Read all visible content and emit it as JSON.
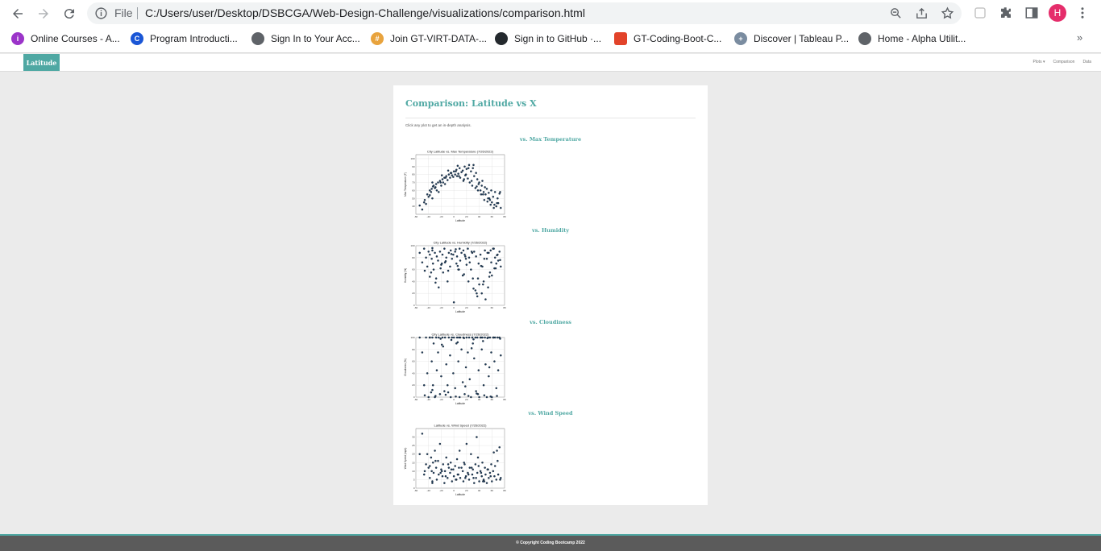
{
  "browser": {
    "file_label": "File",
    "url": "C:/Users/user/Desktop/DSBCGA/Web-Design-Challenge/visualizations/comparison.html",
    "profile_initial": "H",
    "bookmarks": [
      {
        "label": "Online Courses - A...",
        "icon": "globe-purple-icon",
        "color": "#9b34c9"
      },
      {
        "label": "Program Introducti...",
        "icon": "c-logo-icon",
        "color": "#1a56d6"
      },
      {
        "label": "Sign In to Your Acc...",
        "icon": "globe-icon",
        "color": "#5f6368"
      },
      {
        "label": "Join GT-VIRT-DATA-...",
        "icon": "slack-icon",
        "color": "#e8a33d"
      },
      {
        "label": "Sign in to GitHub ·...",
        "icon": "github-icon",
        "color": "#24292e"
      },
      {
        "label": "GT-Coding-Boot-C...",
        "icon": "gitlab-icon",
        "color": "#e2432a"
      },
      {
        "label": "Discover | Tableau P...",
        "icon": "tableau-icon",
        "color": "#7a8ca0"
      },
      {
        "label": "Home - Alpha Utilit...",
        "icon": "globe-icon",
        "color": "#5f6368"
      }
    ]
  },
  "site": {
    "brand": "Latitude",
    "nav": [
      "Plots ▾",
      "Comparison",
      "Data"
    ]
  },
  "page": {
    "title": "Comparison: Latitude vs X",
    "intro": "Click any plot to get an in-depth analysis.",
    "sections": [
      {
        "heading": "vs. Max Temperature"
      },
      {
        "heading": "vs. Humidity"
      },
      {
        "heading": "vs. Cloudiness"
      },
      {
        "heading": "vs. Wind Speed"
      }
    ]
  },
  "footer": {
    "text": "© Copyright Coding Bootcamp 2022"
  },
  "colors": {
    "accent": "#4fa8a3",
    "points": "#1f3d5c",
    "footer": "#5b5b5b"
  },
  "chart_data": [
    {
      "type": "scatter",
      "title": "City Latitude vs. Max Temperature (7/26/2022)",
      "xlabel": "Latitude",
      "ylabel": "Max Temperature (F)",
      "xlim": [
        -60,
        80
      ],
      "ylim": [
        30,
        105
      ],
      "xticks": [
        -60,
        -40,
        -20,
        0,
        20,
        40,
        60,
        80
      ],
      "yticks": [
        40,
        50,
        60,
        70,
        80,
        90,
        100
      ],
      "grid": true,
      "x": [
        -54,
        -50,
        -47,
        -44,
        -42,
        -40,
        -38,
        -36,
        -35,
        -34,
        -33,
        -32,
        -30,
        -28,
        -27,
        -25,
        -24,
        -22,
        -20,
        -18,
        -17,
        -15,
        -14,
        -12,
        -10,
        -8,
        -6,
        -5,
        -3,
        -1,
        0,
        2,
        4,
        5,
        7,
        9,
        10,
        12,
        14,
        15,
        17,
        19,
        20,
        22,
        24,
        25,
        27,
        29,
        30,
        32,
        34,
        35,
        37,
        39,
        40,
        42,
        44,
        45,
        47,
        49,
        50,
        52,
        54,
        55,
        57,
        59,
        60,
        62,
        64,
        65,
        67,
        69,
        70,
        72,
        74,
        -46,
        -38,
        -29,
        -21,
        -13,
        -4,
        3,
        8,
        16,
        23,
        31,
        38,
        43,
        48,
        53,
        58,
        63,
        68,
        73,
        -34,
        -19,
        -9,
        6,
        18,
        28,
        36,
        46,
        56,
        66
      ],
      "y": [
        41,
        36,
        45,
        43,
        55,
        52,
        60,
        58,
        62,
        50,
        65,
        66,
        63,
        68,
        60,
        70,
        58,
        72,
        66,
        74,
        70,
        76,
        68,
        78,
        73,
        80,
        76,
        82,
        79,
        77,
        84,
        80,
        86,
        78,
        81,
        88,
        76,
        83,
        85,
        72,
        90,
        80,
        87,
        75,
        92,
        70,
        84,
        66,
        88,
        78,
        63,
        82,
        74,
        68,
        70,
        60,
        66,
        72,
        58,
        64,
        55,
        62,
        50,
        57,
        48,
        60,
        45,
        52,
        42,
        58,
        40,
        50,
        44,
        56,
        38,
        48,
        54,
        64,
        70,
        76,
        82,
        84,
        78,
        74,
        88,
        92,
        60,
        55,
        48,
        46,
        42,
        38,
        44,
        58,
        70,
        79,
        85,
        91,
        79,
        72,
        65,
        55,
        50
      ],
      "name": ""
    },
    {
      "type": "scatter",
      "title": "City Latitude vs. Humidity (7/26/2022)",
      "xlabel": "Latitude",
      "ylabel": "Humidity (%)",
      "xlim": [
        -60,
        80
      ],
      "ylim": [
        0,
        100
      ],
      "xticks": [
        -60,
        -40,
        -20,
        0,
        20,
        40,
        60,
        80
      ],
      "yticks": [
        0,
        20,
        40,
        60,
        80,
        100
      ],
      "grid": true,
      "x": [
        -54,
        -50,
        -47,
        -44,
        -42,
        -40,
        -38,
        -36,
        -35,
        -34,
        -33,
        -32,
        -30,
        -28,
        -27,
        -25,
        -24,
        -22,
        -20,
        -18,
        -17,
        -15,
        -14,
        -12,
        -10,
        -8,
        -6,
        -5,
        -3,
        -1,
        0,
        2,
        4,
        5,
        7,
        9,
        10,
        12,
        14,
        15,
        17,
        19,
        20,
        22,
        24,
        25,
        27,
        29,
        30,
        32,
        34,
        35,
        37,
        39,
        40,
        42,
        44,
        45,
        47,
        49,
        50,
        52,
        54,
        55,
        57,
        59,
        60,
        62,
        64,
        65,
        67,
        69,
        70,
        72,
        74,
        -46,
        -38,
        -29,
        -21,
        -13,
        -4,
        3,
        8,
        16,
        23,
        31,
        38,
        43,
        48,
        53,
        58,
        63,
        68,
        73,
        -34,
        -19,
        -9,
        6,
        18,
        28,
        36,
        46,
        56,
        66
      ],
      "y": [
        88,
        72,
        95,
        80,
        65,
        90,
        85,
        55,
        78,
        92,
        70,
        60,
        88,
        45,
        82,
        75,
        30,
        90,
        68,
        85,
        55,
        95,
        72,
        80,
        40,
        88,
        65,
        92,
        78,
        85,
        5,
        90,
        70,
        82,
        60,
        95,
        75,
        88,
        50,
        92,
        85,
        78,
        68,
        95,
        80,
        72,
        60,
        88,
        45,
        90,
        25,
        82,
        15,
        70,
        35,
        85,
        20,
        65,
        40,
        92,
        10,
        78,
        30,
        88,
        55,
        72,
        50,
        95,
        62,
        80,
        70,
        85,
        75,
        90,
        65,
        58,
        48,
        38,
        62,
        74,
        86,
        94,
        60,
        52,
        40,
        28,
        45,
        66,
        78,
        88,
        92,
        95,
        84,
        76,
        96,
        70,
        58,
        66,
        82,
        90,
        20,
        35,
        48,
        62
      ],
      "name": ""
    },
    {
      "type": "scatter",
      "title": "City Latitude vs. Cloudiness (7/26/2022)",
      "xlabel": "Latitude",
      "ylabel": "Cloudiness (%)",
      "xlim": [
        -60,
        80
      ],
      "ylim": [
        0,
        100
      ],
      "xticks": [
        -60,
        -40,
        -20,
        0,
        20,
        40,
        60,
        80
      ],
      "yticks": [
        0,
        20,
        40,
        60,
        80,
        100
      ],
      "grid": true,
      "x": [
        -54,
        -50,
        -47,
        -44,
        -42,
        -40,
        -38,
        -36,
        -35,
        -34,
        -33,
        -32,
        -30,
        -28,
        -27,
        -25,
        -24,
        -22,
        -20,
        -18,
        -17,
        -15,
        -14,
        -12,
        -10,
        -8,
        -6,
        -5,
        -3,
        -1,
        0,
        2,
        4,
        5,
        7,
        9,
        10,
        12,
        14,
        15,
        17,
        19,
        20,
        22,
        24,
        25,
        27,
        29,
        30,
        32,
        34,
        35,
        37,
        39,
        40,
        42,
        44,
        45,
        47,
        49,
        50,
        52,
        54,
        55,
        57,
        59,
        60,
        62,
        64,
        65,
        67,
        69,
        70,
        72,
        74,
        -46,
        -38,
        -29,
        -21,
        -13,
        -4,
        3,
        8,
        16,
        23,
        31,
        38,
        43,
        48,
        53,
        58,
        63,
        68,
        73,
        -34,
        -19,
        -9,
        6,
        18,
        28,
        36,
        46,
        56,
        66
      ],
      "y": [
        100,
        75,
        20,
        100,
        40,
        0,
        100,
        8,
        60,
        100,
        20,
        90,
        0,
        100,
        45,
        75,
        100,
        5,
        35,
        100,
        85,
        10,
        100,
        55,
        20,
        100,
        70,
        0,
        100,
        40,
        100,
        15,
        90,
        100,
        60,
        0,
        100,
        80,
        25,
        100,
        5,
        50,
        100,
        75,
        100,
        30,
        0,
        100,
        90,
        65,
        100,
        10,
        100,
        45,
        0,
        100,
        80,
        100,
        20,
        100,
        55,
        0,
        100,
        35,
        100,
        75,
        0,
        100,
        60,
        100,
        15,
        100,
        45,
        100,
        70,
        3,
        100,
        2,
        98,
        4,
        96,
        1,
        100,
        99,
        2,
        97,
        5,
        100,
        3,
        99,
        1,
        100,
        2,
        98,
        12,
        88,
        8,
        92,
        18,
        82,
        6,
        94,
        50
      ],
      "name": ""
    },
    {
      "type": "scatter",
      "title": "Latitude vs. Wind Speed (7/26/2022)",
      "xlabel": "Latitude",
      "ylabel": "Wind Speed (mph)",
      "xlim": [
        -60,
        80
      ],
      "ylim": [
        0,
        35
      ],
      "xticks": [
        -60,
        -40,
        -20,
        0,
        20,
        40,
        60,
        80
      ],
      "yticks": [
        0,
        5,
        10,
        15,
        20,
        25,
        30
      ],
      "grid": true,
      "x": [
        -54,
        -50,
        -47,
        -44,
        -42,
        -40,
        -38,
        -36,
        -35,
        -34,
        -33,
        -32,
        -30,
        -28,
        -27,
        -25,
        -24,
        -22,
        -20,
        -18,
        -17,
        -15,
        -14,
        -12,
        -10,
        -8,
        -6,
        -5,
        -3,
        -1,
        0,
        2,
        4,
        5,
        7,
        9,
        10,
        12,
        14,
        15,
        17,
        19,
        20,
        22,
        24,
        25,
        27,
        29,
        30,
        32,
        34,
        35,
        37,
        39,
        40,
        42,
        44,
        45,
        47,
        49,
        50,
        52,
        54,
        55,
        57,
        59,
        60,
        62,
        64,
        65,
        67,
        69,
        70,
        72,
        74,
        -46,
        -38,
        -29,
        -21,
        -13,
        -4,
        3,
        8,
        16,
        23,
        31,
        38,
        43,
        48,
        53,
        58,
        63,
        68,
        73,
        -34,
        -19,
        -9,
        6,
        18,
        28,
        36,
        46,
        56,
        66
      ],
      "y": [
        20,
        32,
        8,
        14,
        20,
        12,
        6,
        18,
        10,
        4,
        15,
        9,
        22,
        12,
        5,
        16,
        8,
        26,
        11,
        7,
        14,
        3,
        10,
        18,
        6,
        12,
        9,
        15,
        4,
        11,
        7,
        13,
        5,
        17,
        8,
        22,
        6,
        12,
        10,
        4,
        14,
        7,
        26,
        9,
        5,
        12,
        20,
        8,
        11,
        3,
        14,
        6,
        9,
        13,
        4,
        10,
        7,
        15,
        5,
        12,
        8,
        3,
        11,
        6,
        9,
        14,
        4,
        10,
        7,
        13,
        5,
        16,
        8,
        24,
        6,
        10,
        13,
        16,
        9,
        7,
        11,
        5,
        12,
        15,
        8,
        6,
        18,
        9,
        4,
        11,
        7,
        21,
        22,
        5,
        3,
        10,
        14,
        8,
        6,
        12,
        30,
        4
      ],
      "name": ""
    }
  ]
}
